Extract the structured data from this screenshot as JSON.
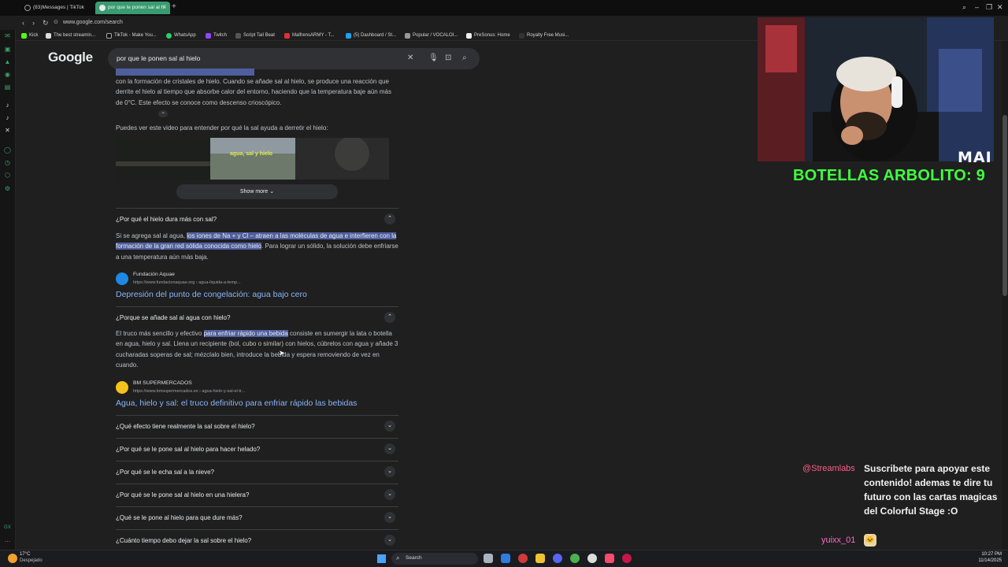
{
  "browser": {
    "tabs": [
      {
        "label": "(83)Messages | TikTok",
        "active": false
      },
      {
        "label": "por que le ponen sal al hi",
        "active": true
      }
    ],
    "new_tab": "+",
    "window_controls": {
      "minimize": "–",
      "restore": "❐",
      "close": "✕"
    },
    "url": "www.google.com/search",
    "bookmarks": [
      "Kick",
      "The best streamin...",
      "TikTok - Make You...",
      "WhatsApp",
      "Twitch",
      "Script Tail Beat",
      "MalfrensARMY - T...",
      "(5) Dashboard / St...",
      "Popular / VOCALOI...",
      "PreSonus: Home",
      "Royalty Free Musi..."
    ]
  },
  "google": {
    "logo": "Google",
    "query": "por que le ponen sal al hielo",
    "intro_text": "con la formación de cristales de hielo. Cuando se añade sal al hielo, se produce una reacción que derrite el hielo al tiempo que absorbe calor del entorno, haciendo que la temperatura baje aún más de 0°C. Este efecto se conoce como descenso crioscópico.",
    "video_caption": "Puedes ver este video para entender por qué la sal ayuda a derretir el hielo:",
    "video_overlay_text": "agua, sal y hielo",
    "show_more": "Show more",
    "qa": [
      {
        "question": "¿Por qué el hielo dura más con sal?",
        "answer_pre": "Si se agrega sal al agua, ",
        "answer_highlight": "los iones de Na + y Cl – atraen a las moléculas de agua e interfieren con la formación de la gran red sólida conocida como hielo",
        "answer_post": ". Para lograr un sólido, la solución debe enfriarse a una temperatura aún más baja.",
        "source_name": "Fundación Aquae",
        "source_url": "https://www.fundacionaquae.org › agua-liquida-a-temp...",
        "link_title": "Depresión del punto de congelación: agua bajo cero"
      },
      {
        "question": "¿Porque se añade sal al agua con hielo?",
        "answer_pre": "El truco más sencillo y efectivo ",
        "answer_highlight": "para enfriar rápido una bebida",
        "answer_post": " consiste en sumergir la lata o botella en agua, hielo y sal. Llena un recipiente (bol, cubo o similar) con hielos, cúbrelos con agua y añade 3 cucharadas soperas de sal; mézclalo bien, introduce la bebida y espera removiendo de vez en cuando.",
        "source_name": "BM SUPERMERCADOS",
        "source_url": "https://www.bmsupermercados.es › agua-hielo-y-sal-el-tr...",
        "link_title": "Agua, hielo y sal: el truco definitivo para enfriar rápido las bebidas"
      }
    ],
    "collapsed_questions": [
      "¿Qué efecto tiene realmente la sal sobre el hielo?",
      "¿Por qué se le pone sal al hielo para hacer helado?",
      "¿Por qué se le echa sal a la nieve?",
      "¿Por qué se le pone sal al hielo en una hielera?",
      "¿Qué se le pone al hielo para que dure más?",
      "¿Cuánto tiempo debo dejar la sal sobre el hielo?"
    ]
  },
  "stream_overlay": {
    "webcam_label": "MAI",
    "counter_text": "BOTELLAS ARBOLITO: 9",
    "chat": [
      {
        "user": "@Streamlabs",
        "message": "Suscribete para apoyar este contenido! ademas te dire tu futuro con las cartas magicas del Colorful Stage :O"
      },
      {
        "user": "yuixx_01",
        "message": ""
      }
    ]
  },
  "taskbar": {
    "temperature": "17°C",
    "weather": "Despejado",
    "search_label": "Search",
    "time": "10:27 PM",
    "date": "11/14/2025"
  },
  "colors": {
    "background": "#1f1f1f",
    "highlight": "#4f5f9e",
    "link": "#8ab4f8",
    "counter": "#40ff3f",
    "active_tab": "#3b9b70"
  }
}
